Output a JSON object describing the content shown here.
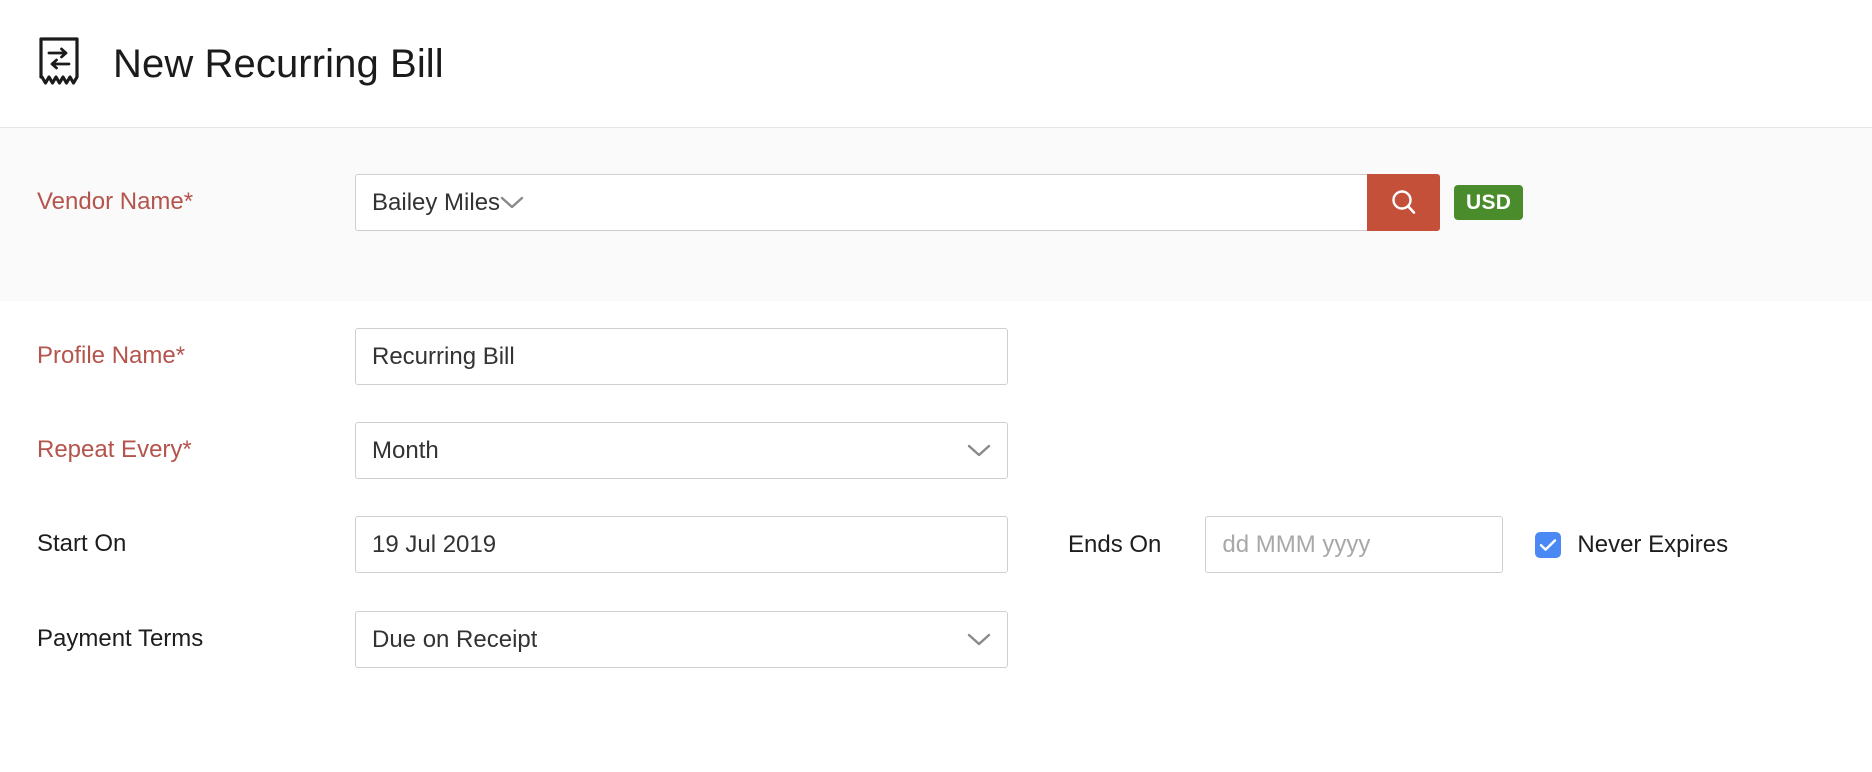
{
  "header": {
    "icon": "recurring-bill-receipt-icon",
    "title": "New Recurring Bill"
  },
  "colors": {
    "required_label": "#b5544c",
    "search_button": "#c4503a",
    "currency_badge": "#4a8b2c",
    "checkbox": "#4a89f3",
    "band_background": "#fafafa",
    "field_border": "#cfcfcf"
  },
  "vendor_section": {
    "label": "Vendor Name*",
    "value": "Bailey Miles",
    "placeholder": "",
    "dropdown_icon": "chevron-down-icon",
    "search_icon": "search-icon",
    "currency_badge": "USD"
  },
  "form": {
    "profile_name": {
      "label": "Profile Name*",
      "value": "Recurring Bill",
      "placeholder": ""
    },
    "repeat_every": {
      "label": "Repeat Every*",
      "value": "Month",
      "dropdown_icon": "chevron-down-icon"
    },
    "start_on": {
      "label": "Start On",
      "value": "19 Jul 2019",
      "placeholder": "dd MMM yyyy"
    },
    "ends_on": {
      "label": "Ends On",
      "value": "",
      "placeholder": "dd MMM yyyy"
    },
    "never_expires": {
      "label": "Never Expires",
      "checked": true,
      "check_icon": "checkmark-icon"
    },
    "payment_terms": {
      "label": "Payment Terms",
      "value": "Due on Receipt",
      "dropdown_icon": "chevron-down-icon"
    }
  }
}
